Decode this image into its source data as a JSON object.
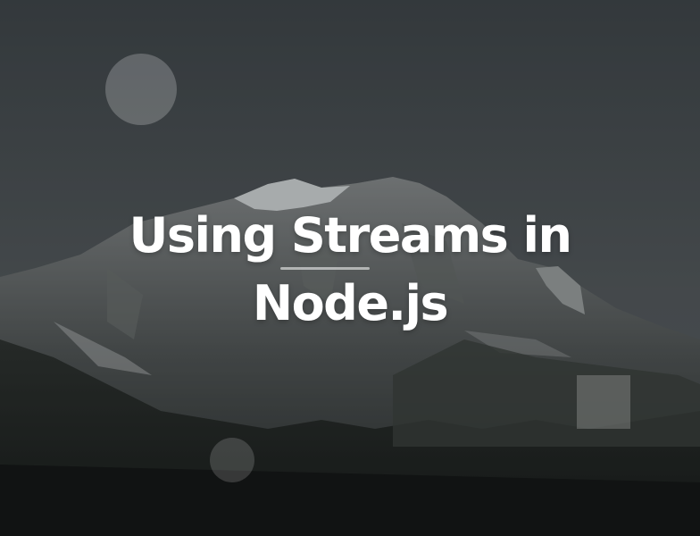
{
  "hero": {
    "title_line_1": "Using Streams in",
    "title_line_2": "Node.js",
    "background_image": "mountain-landscape",
    "colors": {
      "sky": "#4a4f52",
      "overlay": "#14181c",
      "title": "#ffffff"
    }
  }
}
